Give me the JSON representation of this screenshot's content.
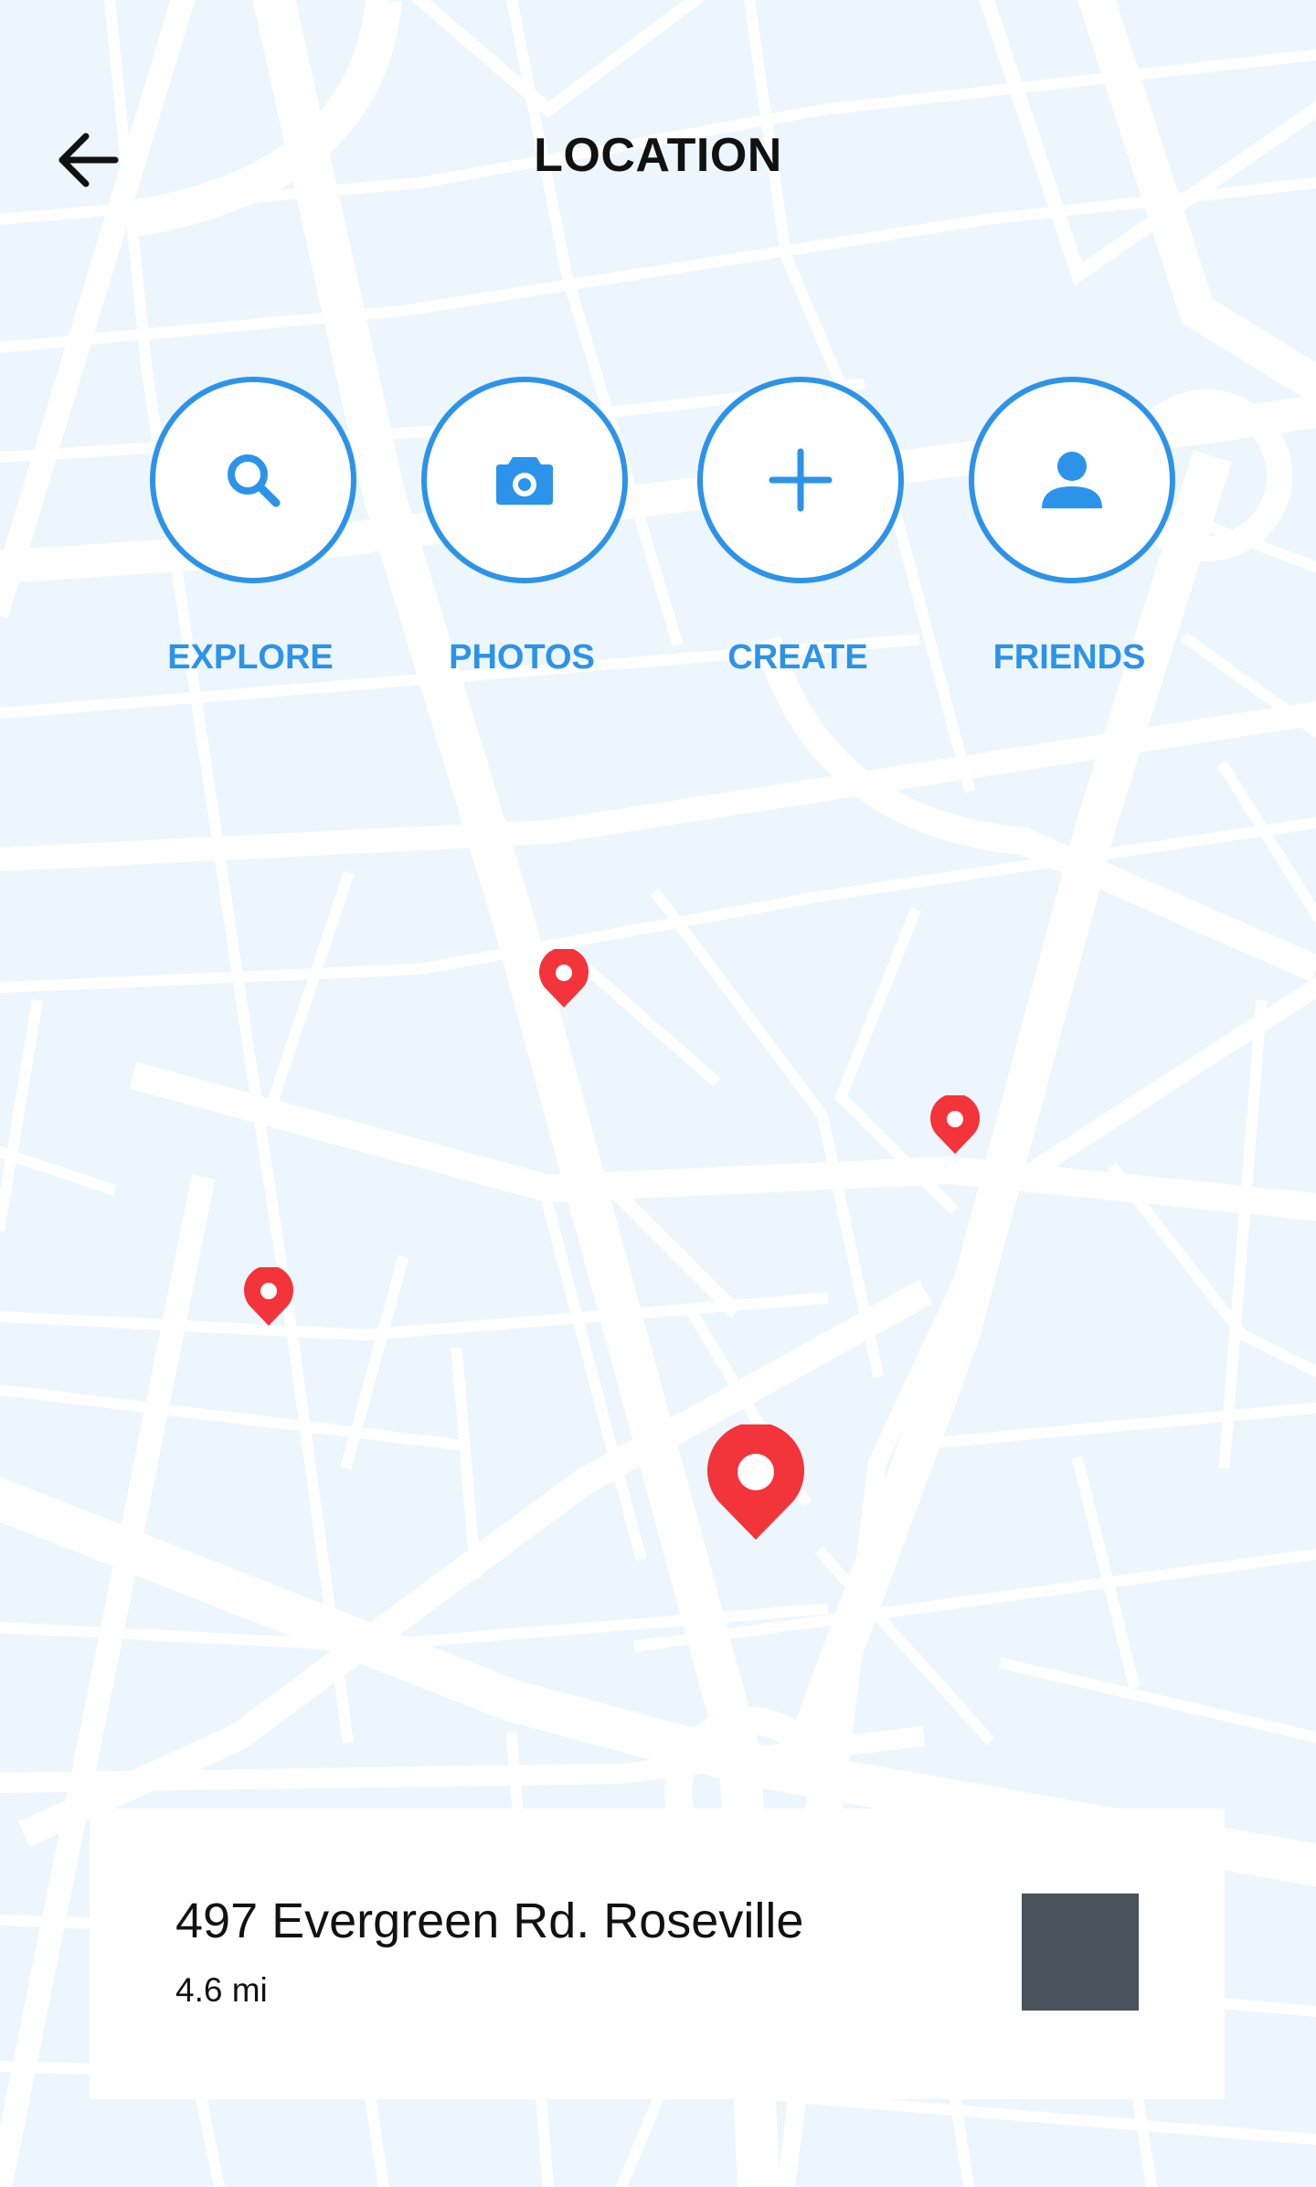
{
  "header": {
    "title": "LOCATION",
    "back_icon": "arrow-left-icon"
  },
  "actions": [
    {
      "id": "explore",
      "label": "EXPLORE",
      "icon": "search-icon"
    },
    {
      "id": "photos",
      "label": "PHOTOS",
      "icon": "camera-icon"
    },
    {
      "id": "create",
      "label": "CREATE",
      "icon": "plus-icon"
    },
    {
      "id": "friends",
      "label": "FRIENDS",
      "icon": "person-icon"
    }
  ],
  "map": {
    "pins": [
      {
        "id": "pin-1",
        "icon": "map-pin-icon"
      },
      {
        "id": "pin-2",
        "icon": "map-pin-icon"
      },
      {
        "id": "pin-3",
        "icon": "map-pin-icon"
      },
      {
        "id": "selected",
        "icon": "map-pin-icon"
      }
    ]
  },
  "location_card": {
    "address": "497 Evergreen Rd. Roseville",
    "distance": "4.6 mi"
  },
  "colors": {
    "accent": "#2c93ea",
    "pin": "#f3343a",
    "map_background": "#eef6fd",
    "road": "#ffffff",
    "thumbnail": "#4a525b"
  }
}
